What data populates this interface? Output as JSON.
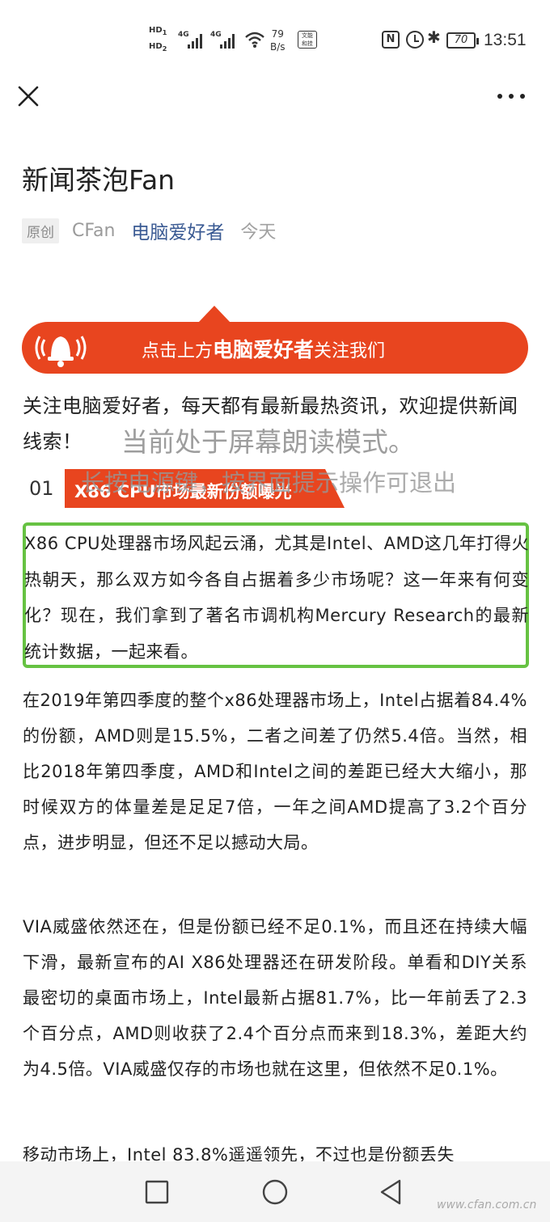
{
  "status_bar": {
    "hd1": "HD",
    "hd1_sub": "1",
    "hd2": "HD",
    "hd2_sub": "2",
    "sig1_label": "4G",
    "sig2_label": "4G",
    "net_speed_value": "79",
    "net_speed_unit": "B/s",
    "extra_icon_text": "文能\n和挂",
    "nfc_label": "N",
    "battery": "70",
    "time": "13:51"
  },
  "header": {
    "close_icon": "close-icon",
    "more_icon": "more-icon"
  },
  "article": {
    "title": "新闻茶泡Fan",
    "tag": "原创",
    "author": "CFan",
    "account": "电脑爱好者",
    "date": "今天"
  },
  "banner": {
    "prefix": "点击上方",
    "account": "电脑爱好者",
    "suffix": "关注我们",
    "color": "#e8451f"
  },
  "intro": "关注电脑爱好者，每天都有最新最热资讯，欢迎提供新闻线索！",
  "overlay": {
    "line1": "当前处于屏幕朗读模式。",
    "line2": "长按电源键，按界面提示操作可退出"
  },
  "section": {
    "number": "01",
    "title": "X86 CPU市场最新份额曝光"
  },
  "paragraphs": {
    "p1": "X86 CPU处理器市场风起云涌，尤其是Intel、AMD这几年打得火热朝天，那么双方如今各自占据着多少市场呢？这一年来有何变化？现在，我们拿到了著名市调机构Mercury Research的最新统计数据，一起来看。",
    "p2": "在2019年第四季度的整个x86处理器市场上，Intel占据着84.4%的份额，AMD则是15.5%，二者之间差了仍然5.4倍。当然，相比2018年第四季度，AMD和Intel之间的差距已经大大缩小，那时候双方的体量差是足足7倍，一年之间AMD提高了3.2个百分点，进步明显，但还不足以撼动大局。",
    "p3": "VIA威盛依然还在，但是份额已经不足0.1%，而且还在持续大幅下滑，最新宣布的AI X86处理器还在研发阶段。单看和DIY关系最密切的桌面市场上，Intel最新占据81.7%，比一年前丢了2.3个百分点，AMD则收获了2.4个百分点而来到18.3%，差距大约为4.5倍。VIA威盛仅存的市场也就在这里，但依然不足0.1%。",
    "p4": "移动市场上，Intel 83.8%遥遥领先，不过也是份额丢失"
  },
  "focus_color": "#66c242",
  "navbar": {
    "recent_icon": "square-icon",
    "home_icon": "circle-icon",
    "back_icon": "triangle-back-icon"
  },
  "watermark": "www.cfan.com.cn"
}
